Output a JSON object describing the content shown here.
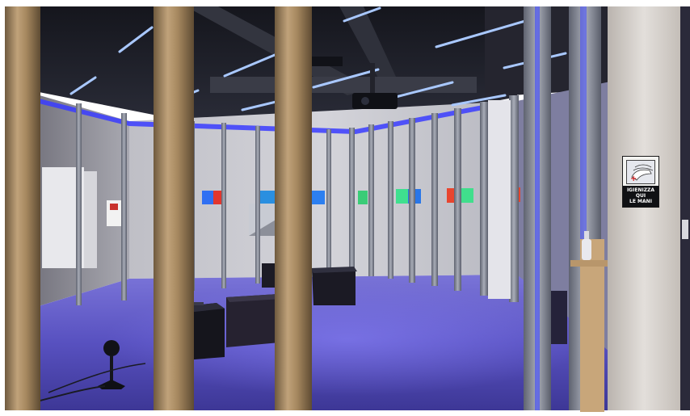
{
  "scene": {
    "colors": {
      "ceiling": "#1d1f2a",
      "wall": "#c9c9d0",
      "floor": "#5e57c4",
      "led": "#9fc2ff",
      "stud": "#8b8f9a",
      "post": "#a68a63",
      "pillar": "#d7d3cf"
    }
  },
  "sign": {
    "lines": [
      "IGIENIZZA",
      "QUI",
      "LE MANI"
    ],
    "icon": "hand-wash-icon"
  }
}
